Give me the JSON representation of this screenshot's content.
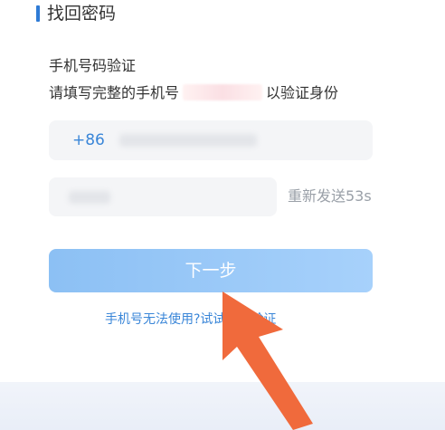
{
  "page": {
    "title": "找回密码"
  },
  "form": {
    "heading": "手机号码验证",
    "instruction_prefix": "请填写完整的手机号",
    "instruction_suffix": "以验证身份",
    "phone_prefix": "+86",
    "resend_label": "重新发送53s",
    "next_label": "下一步",
    "alt_link": "手机号无法使用?试试辅助验证"
  },
  "colors": {
    "accent": "#3a86d8",
    "button": "#99c8f7",
    "arrow": "#f06a3c"
  },
  "icons": {
    "annotation": "orange-pointer-arrow"
  }
}
